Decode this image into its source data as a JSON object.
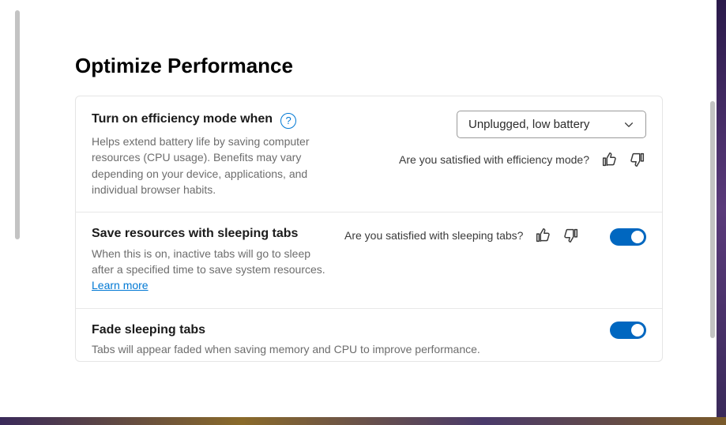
{
  "section": {
    "title": "Optimize Performance"
  },
  "efficiency": {
    "title": "Turn on efficiency mode when",
    "desc": "Helps extend battery life by saving computer resources (CPU usage). Benefits may vary depending on your device, applications, and individual browser habits.",
    "dropdown_selected": "Unplugged, low battery",
    "feedback_question": "Are you satisfied with efficiency mode?"
  },
  "sleeping_tabs": {
    "title": "Save resources with sleeping tabs",
    "desc_prefix": "When this is on, inactive tabs will go to sleep after a specified time to save system resources. ",
    "learn_more": "Learn more",
    "feedback_question": "Are you satisfied with sleeping tabs?",
    "toggle_on": true
  },
  "fade_tabs": {
    "title": "Fade sleeping tabs",
    "desc": "Tabs will appear faded when saving memory and CPU to improve performance.",
    "toggle_on": true
  }
}
